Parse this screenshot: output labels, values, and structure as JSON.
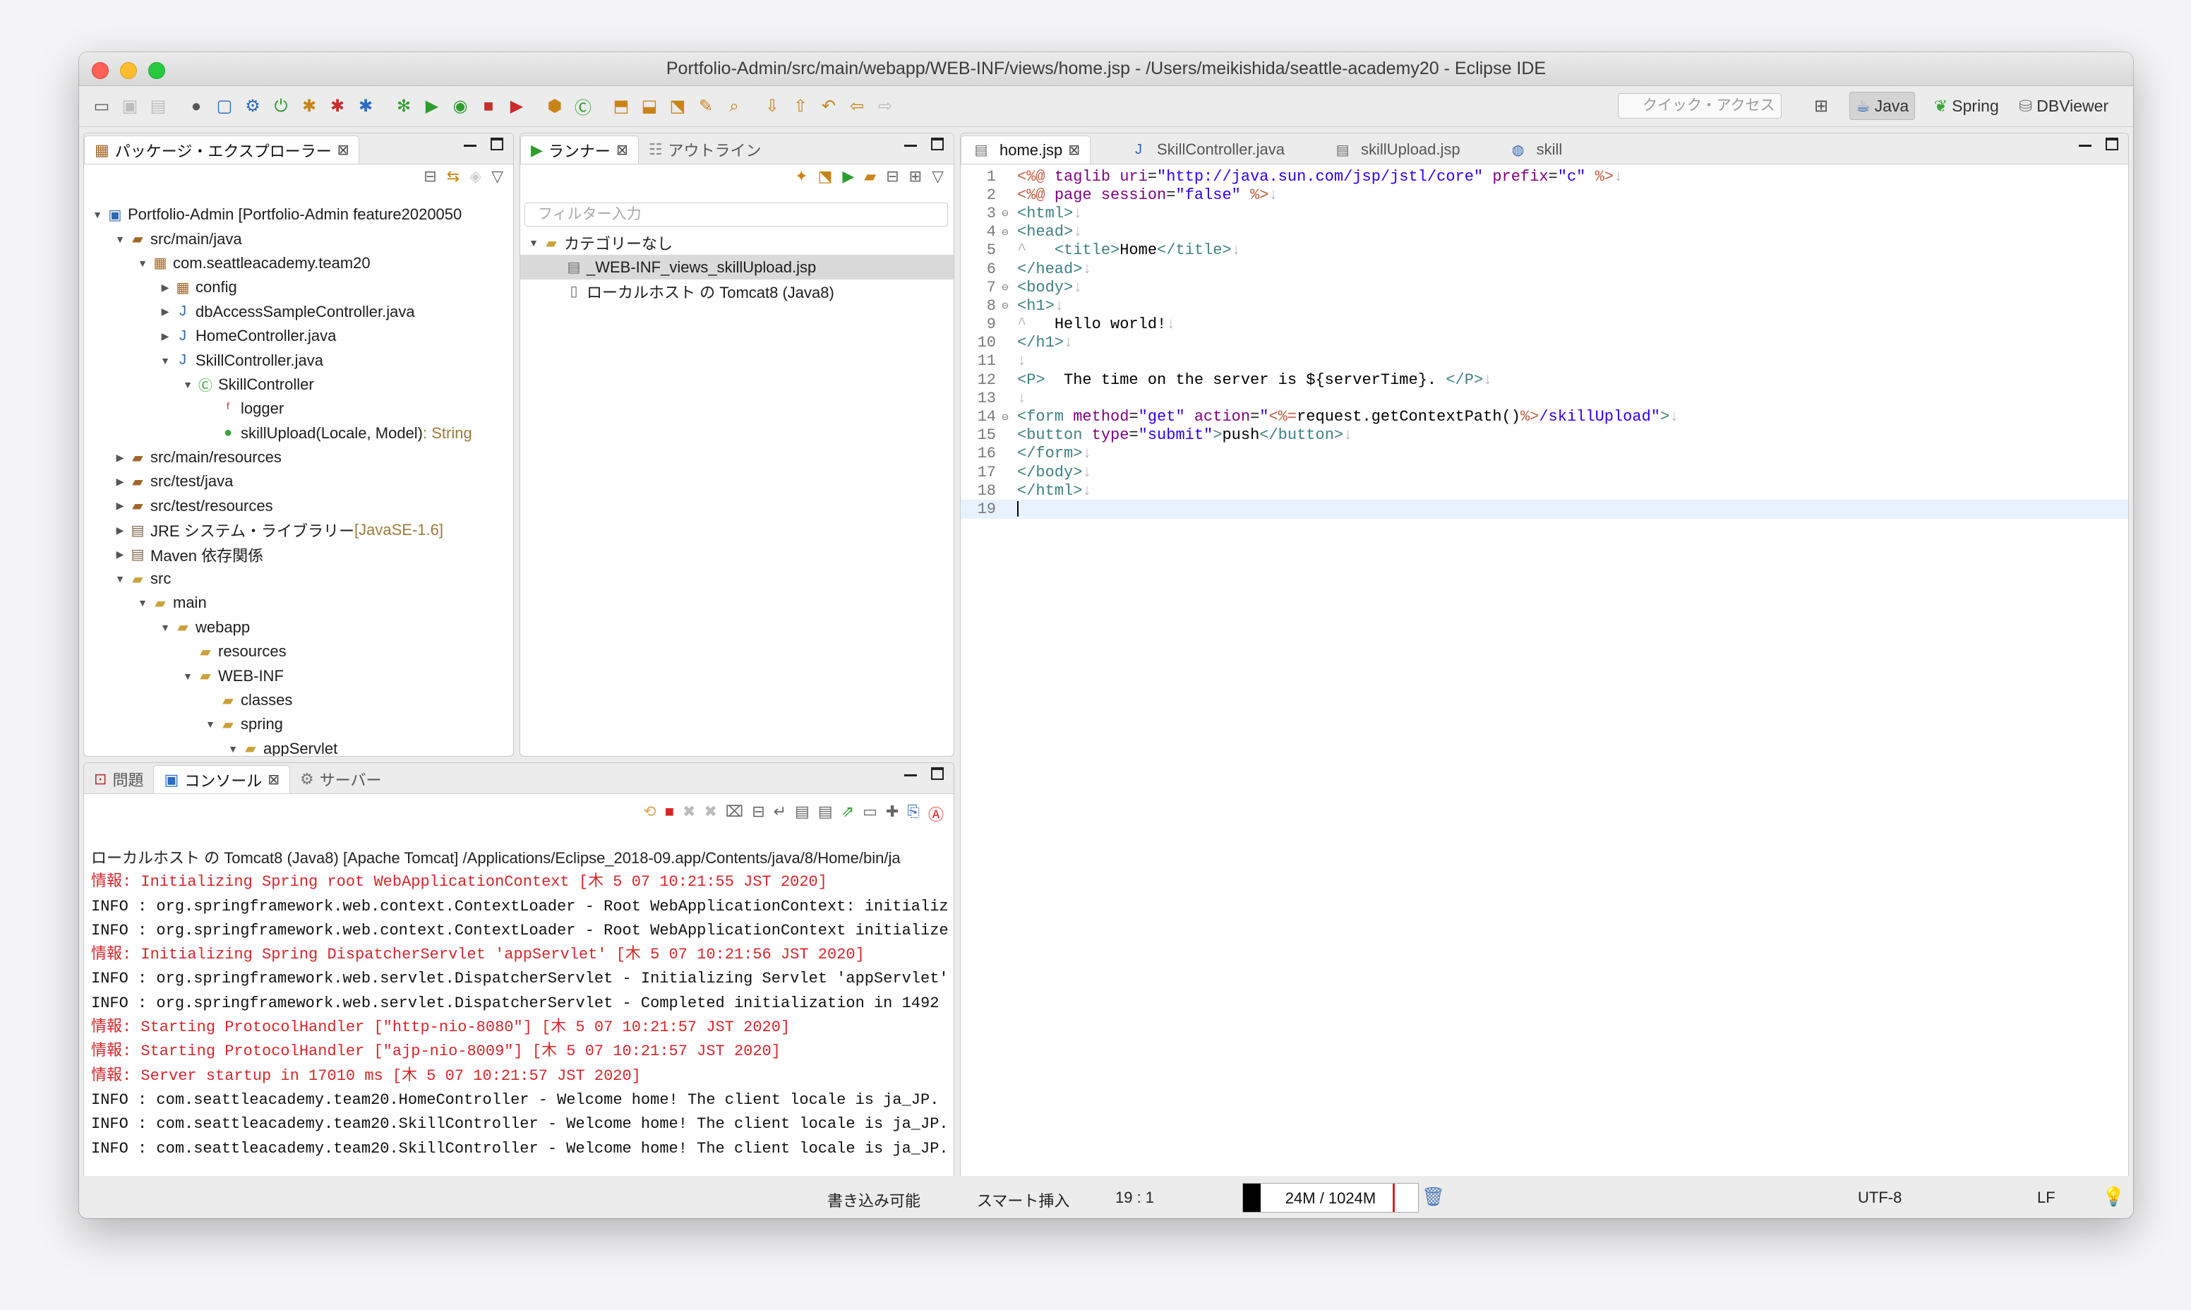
{
  "window": {
    "title": "Portfolio-Admin/src/main/webapp/WEB-INF/views/home.jsp - /Users/meikishida/seattle-academy20 - Eclipse IDE"
  },
  "toolbar": {
    "quick_access_placeholder": "クイック・アクセス",
    "perspectives": [
      "Java",
      "Spring",
      "DBViewer"
    ]
  },
  "package_explorer": {
    "tab_label": "パッケージ・エクスプローラー",
    "tree": [
      {
        "label": "Portfolio-Admin [Portfolio-Admin feature2020050",
        "icon": "project-icon",
        "depth": 0,
        "toggle": "▼"
      },
      {
        "label": "src/main/java",
        "icon": "source-folder-icon",
        "depth": 1,
        "toggle": "▼"
      },
      {
        "label": "com.seattleacademy.team20",
        "icon": "package-icon",
        "depth": 2,
        "toggle": "▼"
      },
      {
        "label": "config",
        "icon": "package-icon",
        "depth": 3,
        "toggle": "▶"
      },
      {
        "label": "dbAccessSampleController.java",
        "icon": "java-file-icon",
        "depth": 3,
        "toggle": "▶"
      },
      {
        "label": "HomeController.java",
        "icon": "java-file-icon",
        "depth": 3,
        "toggle": "▶"
      },
      {
        "label": "SkillController.java",
        "icon": "java-file-icon",
        "depth": 3,
        "toggle": "▼"
      },
      {
        "label": "SkillController",
        "icon": "class-icon",
        "depth": 4,
        "toggle": "▼"
      },
      {
        "label": "logger",
        "icon": "field-icon",
        "depth": 5,
        "toggle": ""
      },
      {
        "label": "skillUpload(Locale, Model)",
        "suffix": " : String",
        "icon": "method-icon",
        "depth": 5,
        "toggle": ""
      },
      {
        "label": "src/main/resources",
        "icon": "source-folder-icon",
        "depth": 1,
        "toggle": "▶"
      },
      {
        "label": "src/test/java",
        "icon": "source-folder-icon",
        "depth": 1,
        "toggle": "▶"
      },
      {
        "label": "src/test/resources",
        "icon": "source-folder-icon",
        "depth": 1,
        "toggle": "▶"
      },
      {
        "label": "JRE システム・ライブラリー",
        "suffix": " [JavaSE-1.6]",
        "icon": "library-icon",
        "depth": 1,
        "toggle": "▶"
      },
      {
        "label": "Maven 依存関係",
        "icon": "library-icon",
        "depth": 1,
        "toggle": "▶"
      },
      {
        "label": "src",
        "icon": "folder-icon",
        "depth": 1,
        "toggle": "▼"
      },
      {
        "label": "main",
        "icon": "folder-icon",
        "depth": 2,
        "toggle": "▼"
      },
      {
        "label": "webapp",
        "icon": "folder-icon",
        "depth": 3,
        "toggle": "▼"
      },
      {
        "label": "resources",
        "icon": "folder-icon",
        "depth": 4,
        "toggle": ""
      },
      {
        "label": "WEB-INF",
        "icon": "folder-icon",
        "depth": 4,
        "toggle": "▼"
      },
      {
        "label": "classes",
        "icon": "folder-icon",
        "depth": 5,
        "toggle": ""
      },
      {
        "label": "spring",
        "icon": "folder-icon",
        "depth": 5,
        "toggle": "▼"
      },
      {
        "label": "appServlet",
        "icon": "folder-icon",
        "depth": 6,
        "toggle": "▼"
      }
    ]
  },
  "runner": {
    "tab_label": "ランナー",
    "outline_tab_label": "アウトライン",
    "filter_placeholder": "フィルター入力",
    "tree": [
      {
        "label": "カテゴリーなし",
        "icon": "folder-icon",
        "depth": 0,
        "toggle": "▼"
      },
      {
        "label": "_WEB-INF_views_skillUpload.jsp",
        "icon": "jsp-run-icon",
        "depth": 1,
        "toggle": "",
        "selected": true
      },
      {
        "label": "ローカルホスト の Tomcat8 (Java8)",
        "icon": "server-icon",
        "depth": 1,
        "toggle": ""
      }
    ]
  },
  "editor": {
    "tabs": [
      {
        "label": "home.jsp",
        "icon": "jsp-file-icon",
        "active": true
      },
      {
        "label": "SkillController.java",
        "icon": "java-file-icon",
        "active": false
      },
      {
        "label": "skillUpload.jsp",
        "icon": "jsp-file-icon",
        "active": false
      },
      {
        "label": "skill",
        "icon": "globe-icon",
        "active": false
      }
    ],
    "lines": [
      {
        "n": "1",
        "fold": "",
        "html": "<span class='dir'>&lt;%@</span> <span class='at'>taglib</span> <span class='at'>uri</span>=<span class='av'>\"http://java.sun.com/jsp/jstl/core\"</span> <span class='at'>prefix</span>=<span class='av'>\"c\"</span> <span class='dir'>%&gt;</span><span class='ws'>↓</span>"
      },
      {
        "n": "2",
        "fold": "",
        "html": "<span class='dir'>&lt;%@</span> <span class='at'>page</span> <span class='at'>session</span>=<span class='av'>\"false\"</span> <span class='dir'>%&gt;</span><span class='ws'>↓</span>"
      },
      {
        "n": "3",
        "fold": "⊖",
        "html": "<span class='tg'>&lt;html&gt;</span><span class='ws'>↓</span>"
      },
      {
        "n": "4",
        "fold": "⊖",
        "html": "<span class='tg'>&lt;head&gt;</span><span class='ws'>↓</span>"
      },
      {
        "n": "5",
        "fold": "",
        "html": "<span class='ws'>^</span>   <span class='tg'>&lt;title&gt;</span><span class='tx'>Home</span><span class='tg'>&lt;/title&gt;</span><span class='ws'>↓</span>"
      },
      {
        "n": "6",
        "fold": "",
        "html": "<span class='tg'>&lt;/head&gt;</span><span class='ws'>↓</span>"
      },
      {
        "n": "7",
        "fold": "⊖",
        "html": "<span class='tg'>&lt;body&gt;</span><span class='ws'>↓</span>"
      },
      {
        "n": "8",
        "fold": "⊖",
        "html": "<span class='tg'>&lt;h1&gt;</span><span class='ws'>↓</span>"
      },
      {
        "n": "9",
        "fold": "",
        "html": "<span class='ws'>^</span>   <span class='tx'>Hello world!</span><span class='ws'>↓</span>"
      },
      {
        "n": "10",
        "fold": "",
        "html": "<span class='tg'>&lt;/h1&gt;</span><span class='ws'>↓</span>"
      },
      {
        "n": "11",
        "fold": "",
        "html": "<span class='ws'>↓</span>"
      },
      {
        "n": "12",
        "fold": "",
        "html": "<span class='tg'>&lt;P&gt;</span>  <span class='tx'>The time on the server is ${serverTime}.</span> <span class='tg'>&lt;/P&gt;</span><span class='ws'>↓</span>"
      },
      {
        "n": "13",
        "fold": "",
        "html": "<span class='ws'>↓</span>"
      },
      {
        "n": "14",
        "fold": "⊖",
        "html": "<span class='tg'>&lt;form</span> <span class='at'>method</span>=<span class='av'>\"get\"</span> <span class='at'>action</span>=<span class='av'>\"</span><span class='dir'>&lt;%=</span><span class='tx'>request.getContextPath()</span><span class='dir'>%&gt;</span><span class='av'>/skillUpload\"</span><span class='tg'>&gt;</span><span class='ws'>↓</span>"
      },
      {
        "n": "15",
        "fold": "",
        "html": "<span class='tg'>&lt;button</span> <span class='at'>type</span>=<span class='av'>\"submit\"</span><span class='tg'>&gt;</span><span class='tx'>push</span><span class='tg'>&lt;/button&gt;</span><span class='ws'>↓</span>"
      },
      {
        "n": "16",
        "fold": "",
        "html": "<span class='tg'>&lt;/form&gt;</span><span class='ws'>↓</span>"
      },
      {
        "n": "17",
        "fold": "",
        "html": "<span class='tg'>&lt;/body&gt;</span><span class='ws'>↓</span>"
      },
      {
        "n": "18",
        "fold": "",
        "html": "<span class='tg'>&lt;/html&gt;</span><span class='ws'>↓</span>"
      },
      {
        "n": "19",
        "fold": "",
        "html": "",
        "current": true
      }
    ]
  },
  "bottom_panel": {
    "tabs": [
      "問題",
      "コンソール",
      "サーバー"
    ],
    "active_tab": "コンソール",
    "header": "ローカルホスト の Tomcat8 (Java8) [Apache Tomcat] /Applications/Eclipse_2018-09.app/Contents/java/8/Home/bin/ja",
    "lines": [
      {
        "text": "情報: Initializing Spring root WebApplicationContext [木 5 07 10:21:55 JST 2020]",
        "level": "err"
      },
      {
        "text": "INFO : org.springframework.web.context.ContextLoader - Root WebApplicationContext: initializ",
        "level": "info"
      },
      {
        "text": "INFO : org.springframework.web.context.ContextLoader - Root WebApplicationContext initialize",
        "level": "info"
      },
      {
        "text": "情報: Initializing Spring DispatcherServlet 'appServlet' [木 5 07 10:21:56 JST 2020]",
        "level": "err"
      },
      {
        "text": "INFO : org.springframework.web.servlet.DispatcherServlet - Initializing Servlet 'appServlet'",
        "level": "info"
      },
      {
        "text": "INFO : org.springframework.web.servlet.DispatcherServlet - Completed initialization in 1492",
        "level": "info"
      },
      {
        "text": "情報: Starting ProtocolHandler [\"http-nio-8080\"] [木 5 07 10:21:57 JST 2020]",
        "level": "err"
      },
      {
        "text": "情報: Starting ProtocolHandler [\"ajp-nio-8009\"] [木 5 07 10:21:57 JST 2020]",
        "level": "err"
      },
      {
        "text": "情報: Server startup in 17010 ms [木 5 07 10:21:57 JST 2020]",
        "level": "err"
      },
      {
        "text": "INFO : com.seattleacademy.team20.HomeController - Welcome home! The client locale is ja_JP.",
        "level": "info"
      },
      {
        "text": "INFO : com.seattleacademy.team20.SkillController - Welcome home! The client locale is ja_JP.",
        "level": "info"
      },
      {
        "text": "INFO : com.seattleacademy.team20.SkillController - Welcome home! The client locale is ja_JP.",
        "level": "info"
      }
    ]
  },
  "status_bar": {
    "writable": "書き込み可能",
    "insert_mode": "スマート挿入",
    "position": "19 : 1",
    "heap": "24M / 1024M",
    "heap_used_fraction": 0.1,
    "encoding": "UTF-8",
    "line_ending": "LF"
  }
}
